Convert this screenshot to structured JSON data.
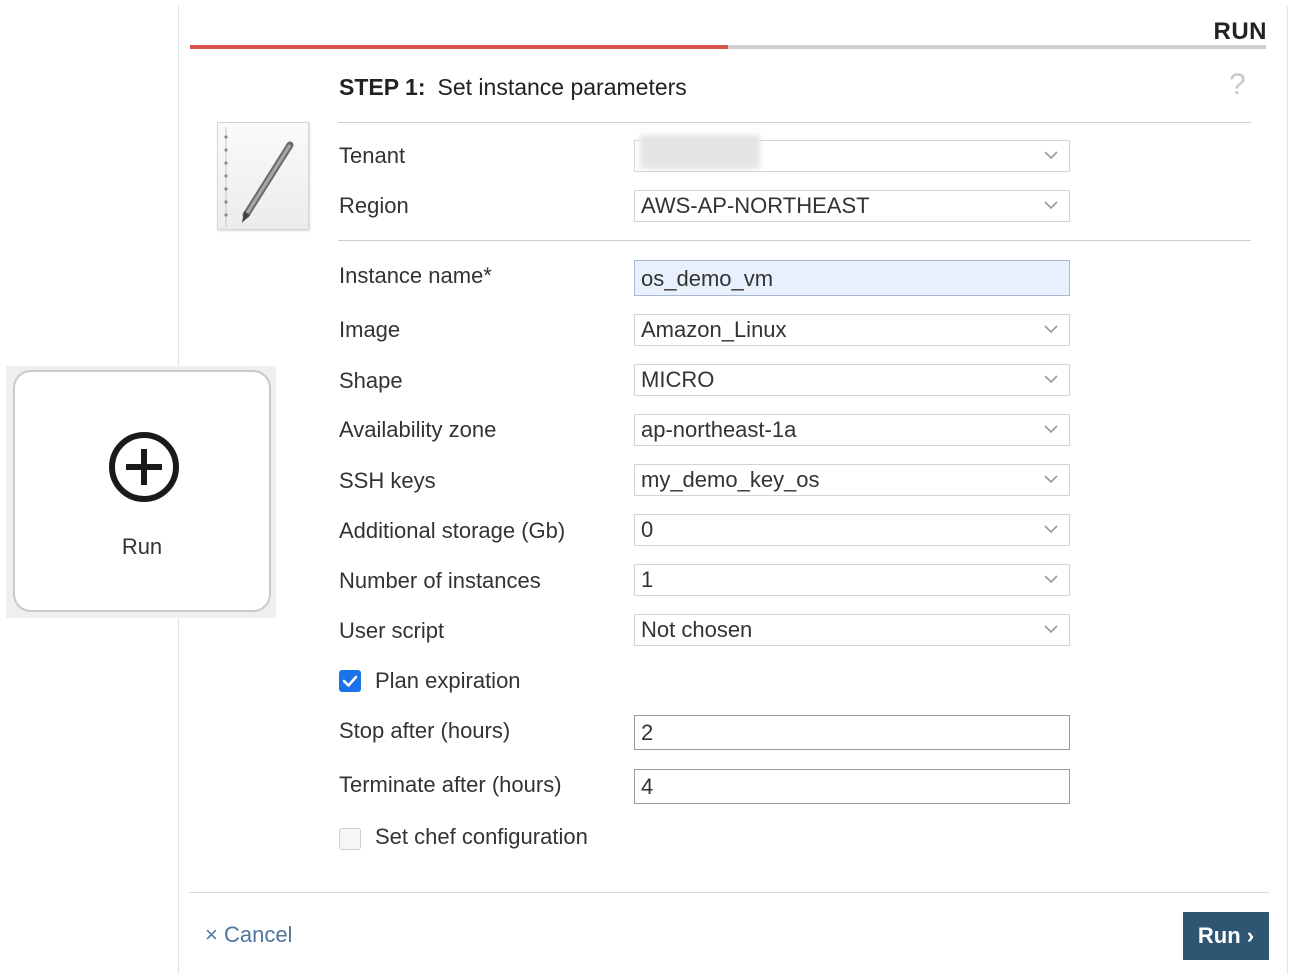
{
  "header": {
    "title": "RUN",
    "progress_percent": 50
  },
  "step": {
    "number": "STEP 1:",
    "title": "Set instance parameters"
  },
  "help_icon": "?",
  "fields": {
    "tenant": {
      "label": "Tenant",
      "value": ""
    },
    "region": {
      "label": "Region",
      "value": "AWS-AP-NORTHEAST"
    },
    "instance_name": {
      "label": "Instance name*",
      "value": "os_demo_vm"
    },
    "image": {
      "label": "Image",
      "value": "Amazon_Linux"
    },
    "shape": {
      "label": "Shape",
      "value": "MICRO"
    },
    "availability_zone": {
      "label": "Availability zone",
      "value": "ap-northeast-1a"
    },
    "ssh_keys": {
      "label": "SSH keys",
      "value": "my_demo_key_os"
    },
    "additional_storage": {
      "label": "Additional storage (Gb)",
      "value": "0"
    },
    "number_of_instances": {
      "label": "Number of instances",
      "value": "1"
    },
    "user_script": {
      "label": "User script",
      "value": "Not chosen"
    },
    "stop_after": {
      "label": "Stop after (hours)",
      "value": "2"
    },
    "terminate_after": {
      "label": "Terminate after (hours)",
      "value": "4"
    }
  },
  "checkboxes": {
    "plan_expiration": {
      "label": "Plan expiration",
      "checked": true
    },
    "chef_configuration": {
      "label": "Set chef configuration",
      "checked": false
    }
  },
  "footer": {
    "cancel_label": "× Cancel",
    "run_label": "Run ›"
  },
  "run_tile": {
    "label": "Run"
  },
  "colors": {
    "accent": "#d9534f",
    "primary_button": "#2e5572",
    "checkbox": "#1a73e8",
    "link": "#5076a0"
  }
}
